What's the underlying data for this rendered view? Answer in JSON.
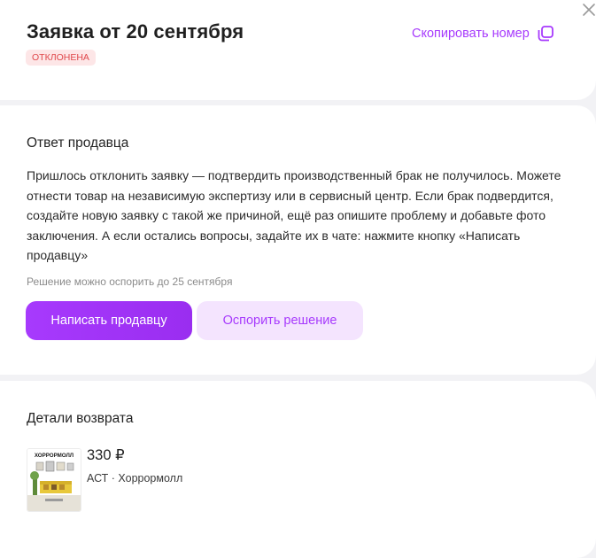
{
  "header": {
    "title": "Заявка от 20 сентября",
    "status_badge": "ОТКЛОНЕНА",
    "copy_number_label": "Скопировать номер"
  },
  "seller_answer": {
    "heading": "Ответ продавца",
    "text": "Пришлось отклонить заявку — подтвердить производственный брак не получилось. Можете отнести товар на независимую экспертизу или в сервисный центр. Если брак подвердится, создайте новую заявку с такой же причиной, ещё раз опишите проблему и добавьте фото заключения. А если остались вопросы, задайте их в чате: нажмите кнопку «Написать продавцу»",
    "deadline_note": "Решение можно оспорить до 25 сентября",
    "write_seller_label": "Написать продавцу",
    "dispute_label": "Оспорить решение"
  },
  "return_details": {
    "heading": "Детали возврата",
    "product": {
      "cover_title": "ХОРРОРМОЛЛ",
      "price": "330 ₽",
      "meta": "АСТ · Хоррормолл"
    }
  },
  "colors": {
    "accent": "#a73afd",
    "accent_light": "#f4e4fe",
    "status_red": "#e0484c",
    "status_red_bg": "#fde6e7",
    "background": "#f2f2f5"
  },
  "icons": {
    "copy": "copy-icon",
    "close": "close-icon"
  }
}
